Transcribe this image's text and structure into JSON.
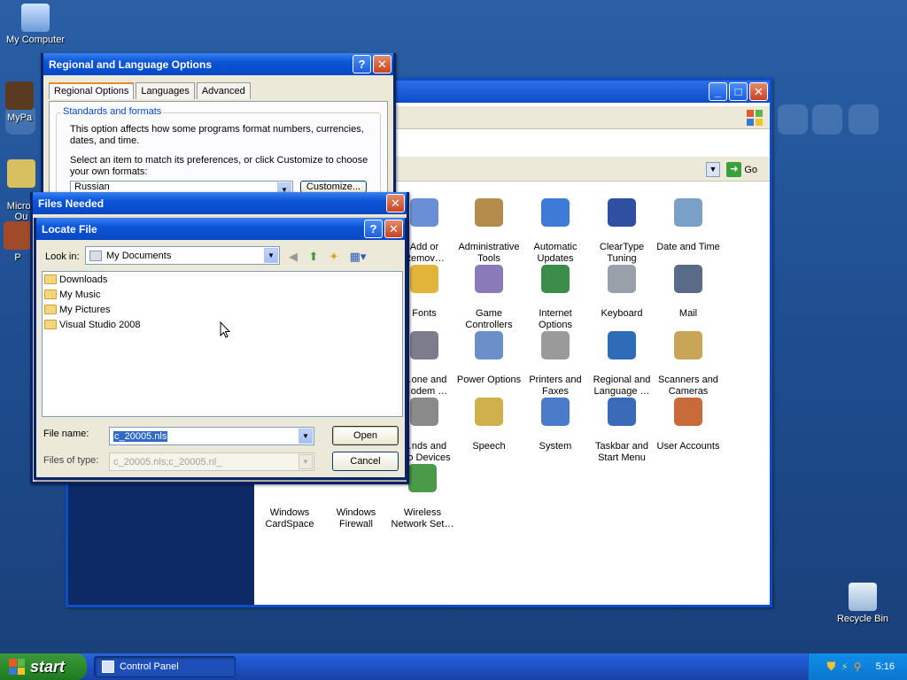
{
  "desktop": {
    "icons": [
      {
        "label": "My Computer"
      },
      {
        "label": "MyPa"
      },
      {
        "label": "Micros\nOu"
      },
      {
        "label": "P"
      },
      {
        "label": "Recycle Bin"
      }
    ]
  },
  "control_panel": {
    "address_go": "Go",
    "items": [
      {
        "label": "Add or\nRemov…",
        "color": "#6b8fd6"
      },
      {
        "label": "Administrative\nTools",
        "color": "#b38b4a"
      },
      {
        "label": "Automatic\nUpdates",
        "color": "#3d7bd6"
      },
      {
        "label": "ClearType\nTuning",
        "color": "#2f4fa0"
      },
      {
        "label": "Date and Time",
        "color": "#7aa0c8"
      },
      {
        "label": "Fonts",
        "color": "#e2b43a"
      },
      {
        "label": "Game\nControllers",
        "color": "#8a7ab8"
      },
      {
        "label": "Internet\nOptions",
        "color": "#3d8d4a"
      },
      {
        "label": "Keyboard",
        "color": "#9aa0aa"
      },
      {
        "label": "Mail",
        "color": "#5a6b88"
      },
      {
        "label": "…one and\n…odem …",
        "color": "#7c7c8c"
      },
      {
        "label": "Power Options",
        "color": "#6b8fc8"
      },
      {
        "label": "Printers and\nFaxes",
        "color": "#9a9a9a"
      },
      {
        "label": "Regional and\nLanguage …",
        "color": "#2e6bb8"
      },
      {
        "label": "Scanners and\nCameras",
        "color": "#c9a55a"
      },
      {
        "label": "…nds and\n…o Devices",
        "color": "#8a8a8a"
      },
      {
        "label": "Speech",
        "color": "#d0b04a"
      },
      {
        "label": "System",
        "color": "#4a7ac8"
      },
      {
        "label": "Taskbar and\nStart Menu",
        "color": "#3a6bb8"
      },
      {
        "label": "User Accounts",
        "color": "#c86a3a"
      },
      {
        "label": "Windows\nCardSpace",
        "color": "#ffffff"
      },
      {
        "label": "Windows\nFirewall",
        "color": "#ffffff"
      },
      {
        "label": "Wireless\nNetwork Set…",
        "color": "#4a9a4a"
      }
    ]
  },
  "regional_dialog": {
    "title": "Regional and Language Options",
    "tabs": [
      "Regional Options",
      "Languages",
      "Advanced"
    ],
    "group_title": "Standards and formats",
    "text1": "This option affects how some programs format numbers, currencies, dates, and time.",
    "text2": "Select an item to match its preferences, or click Customize to choose your own formats:",
    "locale_value": "Russian",
    "customize_label": "Customize..."
  },
  "files_needed": {
    "title": "Files Needed"
  },
  "locate_file": {
    "title": "Locate File",
    "look_in_label": "Look in:",
    "look_in_value": "My Documents",
    "files": [
      "Downloads",
      "My Music",
      "My Pictures",
      "Visual Studio 2008"
    ],
    "file_name_label": "File name:",
    "file_name_value": "c_20005.nls",
    "files_of_type_label": "Files of type:",
    "files_of_type_value": "c_20005.nls;c_20005.nl_",
    "open_label": "Open",
    "cancel_label": "Cancel"
  },
  "taskbar": {
    "start_label": "start",
    "task_label": "Control Panel",
    "clock": "5:16"
  }
}
